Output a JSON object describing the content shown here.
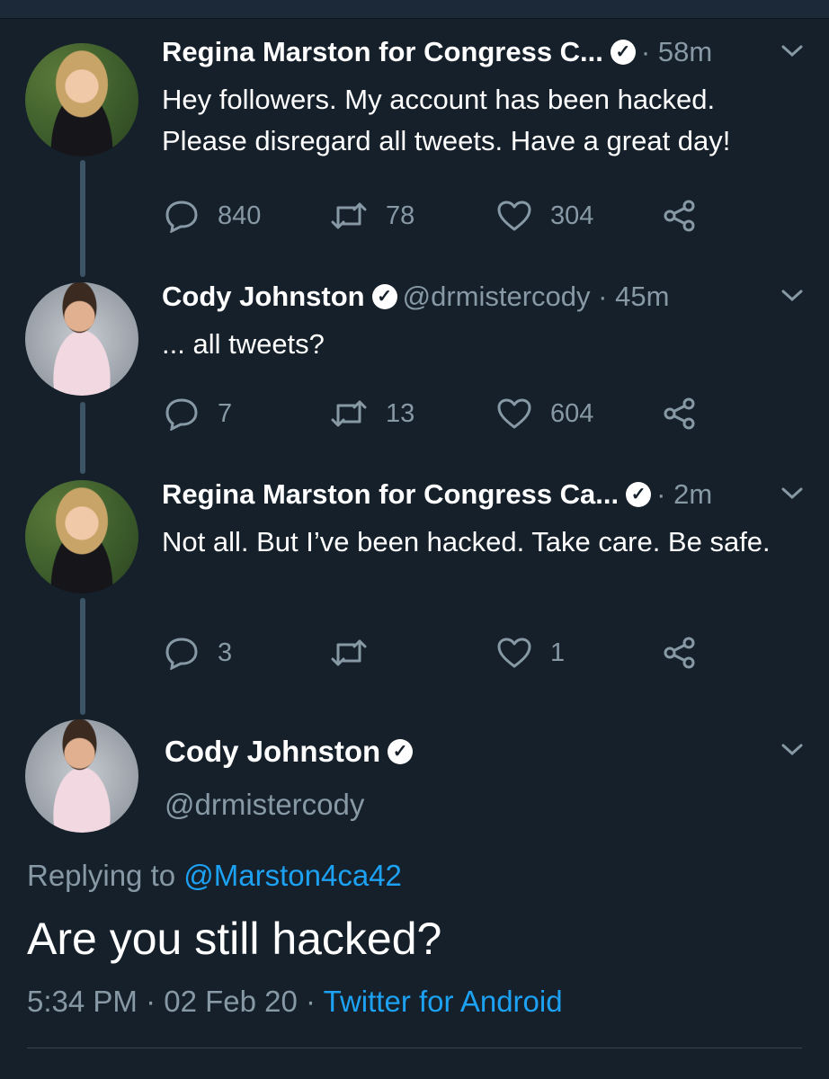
{
  "tweets": [
    {
      "name": "Regina Marston for Congress C...",
      "handle": "",
      "time": "58m",
      "text": "Hey followers. My account has been hacked. Please disregard all tweets. Have a great day!",
      "reply_count": "840",
      "retweet_count": "78",
      "like_count": "304"
    },
    {
      "name": "Cody Johnston",
      "handle": "@drmistercody",
      "time": "45m",
      "text": "... all tweets?",
      "reply_count": "7",
      "retweet_count": "13",
      "like_count": "604"
    },
    {
      "name": "Regina Marston for Congress Ca...",
      "handle": "",
      "time": "2m",
      "text": "Not all. But I’ve been hacked. Take care. Be safe.",
      "reply_count": "3",
      "retweet_count": "",
      "like_count": "1"
    }
  ],
  "main_tweet": {
    "name": "Cody Johnston",
    "handle": "@drmistercody",
    "replying_prefix": "Replying to",
    "replying_to": "@Marston4ca42",
    "text": "Are you still hacked?",
    "time": "5:34 PM",
    "date": "02 Feb 20",
    "client": "Twitter for Android"
  },
  "separator": "·",
  "icons": [
    "reply-icon",
    "retweet-icon",
    "like-icon",
    "share-icon",
    "verified-icon",
    "chevron-down-icon"
  ],
  "colors": {
    "background": "#15202b",
    "muted": "#8899a6",
    "link": "#1da1f2",
    "thread_line": "#3d5466"
  }
}
